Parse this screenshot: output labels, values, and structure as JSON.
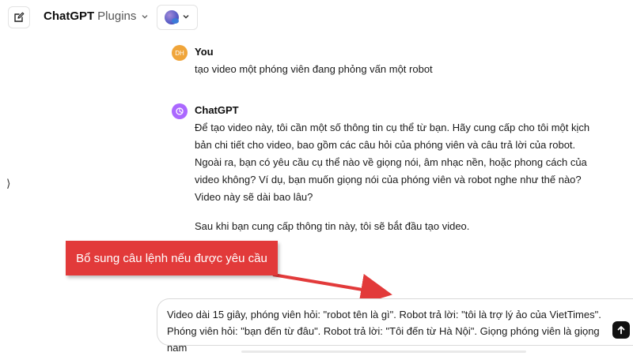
{
  "header": {
    "model_name": "ChatGPT",
    "model_variant": "Plugins"
  },
  "icons": {
    "new_chat": "edit-icon",
    "chevron": "chevron-down-icon",
    "plugin": "plugin-logo-icon",
    "sidebar_toggle": "sidebar-handle-icon",
    "send": "arrow-up-icon"
  },
  "sidebar_handle": "⟩",
  "messages": [
    {
      "sender": "You",
      "avatar_text": "DH",
      "text": "tạo video một phóng viên đang phỏng vấn một robot"
    },
    {
      "sender": "ChatGPT",
      "paragraphs": [
        "Để tạo video này, tôi cần một số thông tin cụ thể từ bạn. Hãy cung cấp cho tôi một kịch bản chi tiết cho video, bao gồm các câu hỏi của phóng viên và câu trả lời của robot. Ngoài ra, bạn có yêu cầu cụ thể nào về giọng nói, âm nhạc nền, hoặc phong cách của video không? Ví dụ, bạn muốn giọng nói của phóng viên và robot nghe như thế nào? Video này sẽ dài bao lâu?",
        "Sau khi bạn cung cấp thông tin này, tôi sẽ bắt đầu tạo video."
      ]
    }
  ],
  "annotation": {
    "label": "Bổ sung câu lệnh nếu được yêu cầu",
    "color": "#e23a3a"
  },
  "composer": {
    "value": "Video dài 15 giây, phóng viên hỏi: \"robot tên là gì\". Robot trả lời: \"tôi là trợ lý ảo của VietTimes\". Phóng viên hỏi: \"bạn đến từ đâu\". Robot trả lời: \"Tôi đến từ Hà Nội\". Giọng phóng viên là giọng nam"
  }
}
